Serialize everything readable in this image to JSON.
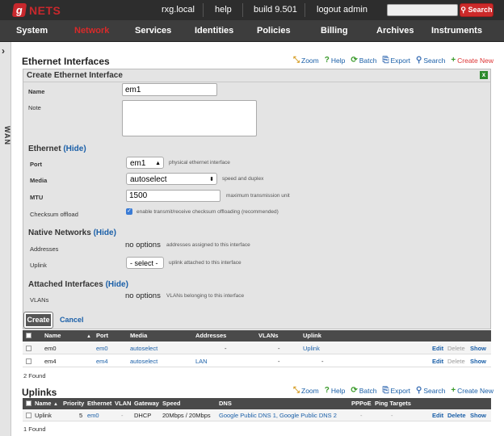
{
  "topbar": {
    "brand": "NETS",
    "brand_mark": "g",
    "links": [
      "rxg.local",
      "help",
      "build 9.501",
      "logout admin"
    ],
    "search_button": "Search"
  },
  "nav": [
    "System",
    "Network",
    "Services",
    "Identities",
    "Policies",
    "Billing",
    "Archives",
    "Instruments"
  ],
  "side_tab": "WAN",
  "ethernet": {
    "title": "Ethernet Interfaces",
    "toolbar": {
      "zoom": "Zoom",
      "help": "Help",
      "batch": "Batch",
      "export": "Export",
      "search": "Search",
      "create_new": "Create New"
    },
    "form": {
      "title": "Create Ethernet Interface",
      "close": "x",
      "name_label": "Name",
      "name_value": "em1",
      "note_label": "Note",
      "grp_ethernet": "Ethernet",
      "hide": "(Hide)",
      "port_label": "Port",
      "port_value": "em1",
      "port_hint": "physical ethernet interface",
      "media_label": "Media",
      "media_value": "autoselect",
      "media_hint": "speed and duplex",
      "mtu_label": "MTU",
      "mtu_value": "1500",
      "mtu_hint": "maximum transmission unit",
      "checksum_label": "Checksum offload",
      "checksum_hint": "enable transmit/receive checksum offloading (recommended)",
      "grp_native": "Native Networks",
      "addresses_label": "Addresses",
      "addresses_value": "no options",
      "addresses_hint": "addresses assigned to this interface",
      "uplink_label": "Uplink",
      "uplink_value": "- select -",
      "uplink_hint": "uplink attached to this interface",
      "grp_attached": "Attached Interfaces",
      "vlans_label": "VLANs",
      "vlans_value": "no options",
      "vlans_hint": "VLANs belonging to this interface",
      "create": "Create",
      "cancel": "Cancel"
    },
    "columns": [
      "Name",
      "Port",
      "Media",
      "Addresses",
      "VLANs",
      "Uplink"
    ],
    "rows": [
      {
        "name": "em0",
        "port": "em0",
        "media": "autoselect",
        "addresses": "-",
        "vlans": "-",
        "uplink": "Uplink",
        "edit": "Edit",
        "delete": "Delete",
        "show": "Show"
      },
      {
        "name": "em4",
        "port": "em4",
        "media": "autoselect",
        "addresses": "LAN",
        "vlans": "-",
        "uplink": "-",
        "edit": "Edit",
        "delete": "Delete",
        "show": "Show"
      }
    ],
    "found": "2 Found"
  },
  "uplinks": {
    "title": "Uplinks",
    "toolbar": {
      "zoom": "Zoom",
      "help": "Help",
      "batch": "Batch",
      "export": "Export",
      "search": "Search",
      "create_new": "Create New"
    },
    "columns": [
      "Name",
      "Priority",
      "Ethernet",
      "VLAN",
      "Gateway",
      "Speed",
      "DNS",
      "PPPoE",
      "Ping Targets"
    ],
    "rows": [
      {
        "name": "Uplink",
        "priority": "5",
        "ethernet": "em0",
        "vlan": "-",
        "gateway": "DHCP",
        "speed": "20Mbps / 20Mbps",
        "dns": "Google Public DNS 1, Google Public DNS 2",
        "pppoe": "-",
        "ping": "-",
        "edit": "Edit",
        "delete": "Delete",
        "show": "Show"
      }
    ],
    "found": "1 Found"
  }
}
